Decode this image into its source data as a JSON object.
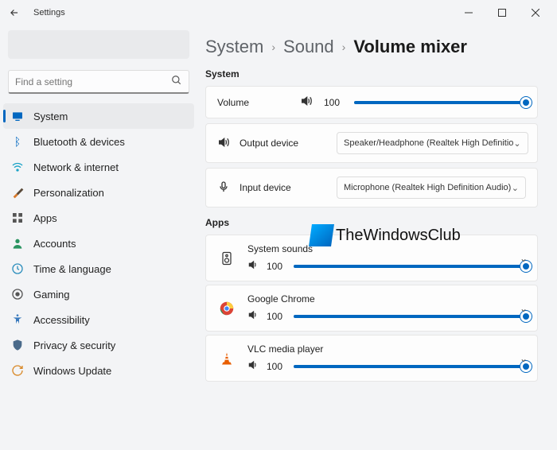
{
  "titlebar": {
    "title": "Settings"
  },
  "sidebar": {
    "search_placeholder": "Find a setting",
    "items": [
      {
        "label": "System"
      },
      {
        "label": "Bluetooth & devices"
      },
      {
        "label": "Network & internet"
      },
      {
        "label": "Personalization"
      },
      {
        "label": "Apps"
      },
      {
        "label": "Accounts"
      },
      {
        "label": "Time & language"
      },
      {
        "label": "Gaming"
      },
      {
        "label": "Accessibility"
      },
      {
        "label": "Privacy & security"
      },
      {
        "label": "Windows Update"
      }
    ]
  },
  "breadcrumb": {
    "a": "System",
    "b": "Sound",
    "c": "Volume mixer"
  },
  "system": {
    "heading": "System",
    "volume_label": "Volume",
    "volume_value": "100",
    "output_label": "Output device",
    "output_value": "Speaker/Headphone (Realtek High Definitio",
    "input_label": "Input device",
    "input_value": "Microphone (Realtek High Definition Audio)"
  },
  "apps": {
    "heading": "Apps",
    "rows": [
      {
        "name": "System sounds",
        "vol": "100"
      },
      {
        "name": "Google Chrome",
        "vol": "100"
      },
      {
        "name": "VLC media player",
        "vol": "100"
      }
    ]
  },
  "watermark": "TheWindowsClub"
}
